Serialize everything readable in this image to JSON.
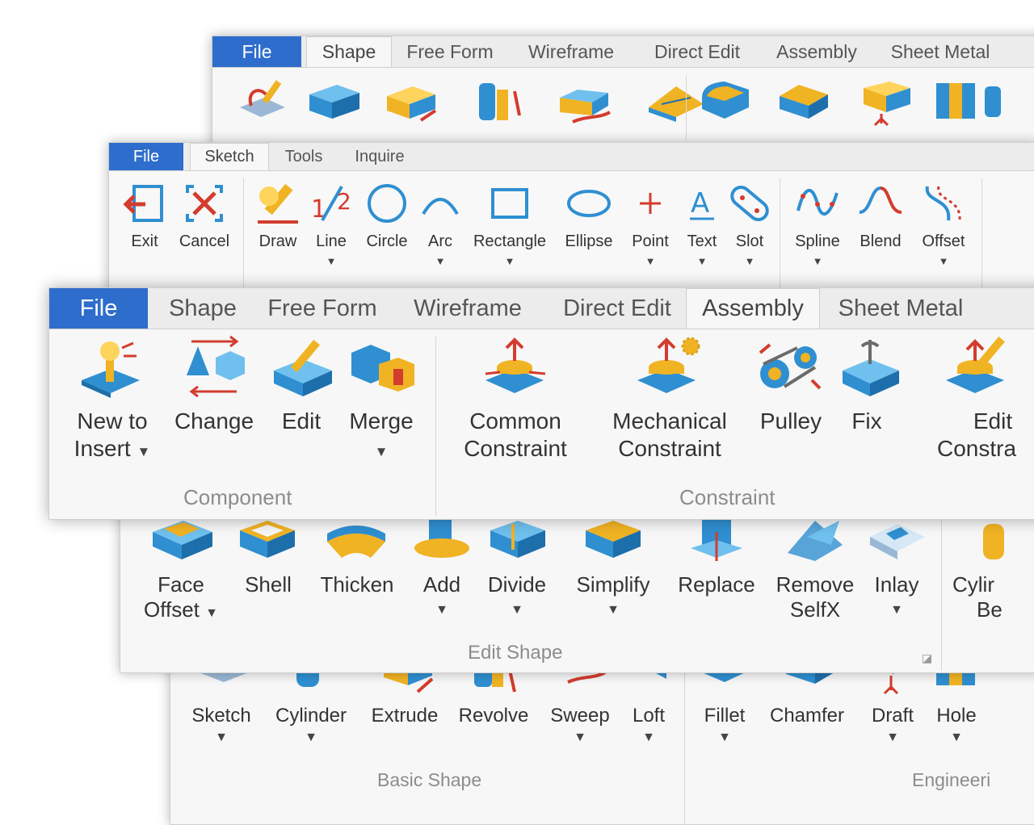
{
  "main_tabs": {
    "file": "File",
    "shape": "Shape",
    "free_form": "Free Form",
    "wireframe": "Wireframe",
    "direct_edit": "Direct Edit",
    "assembly": "Assembly",
    "sheet_metal": "Sheet Metal"
  },
  "sketch_tabs": {
    "file": "File",
    "sketch": "Sketch",
    "tools": "Tools",
    "inquire": "Inquire"
  },
  "sketch_tools": [
    {
      "label": "Exit",
      "icon": "exit-icon"
    },
    {
      "label": "Cancel",
      "icon": "cancel-icon"
    },
    {
      "label": "Draw",
      "icon": "draw-pencil-icon"
    },
    {
      "label": "Line",
      "icon": "line-icon"
    },
    {
      "label": "Circle",
      "icon": "circle-icon"
    },
    {
      "label": "Arc",
      "icon": "arc-icon"
    },
    {
      "label": "Rectangle",
      "icon": "rectangle-icon"
    },
    {
      "label": "Ellipse",
      "icon": "ellipse-icon"
    },
    {
      "label": "Point",
      "icon": "point-icon"
    },
    {
      "label": "Text",
      "icon": "text-icon"
    },
    {
      "label": "Slot",
      "icon": "slot-icon"
    },
    {
      "label": "Spline",
      "icon": "spline-icon"
    },
    {
      "label": "Blend",
      "icon": "blend-icon"
    },
    {
      "label": "Offset",
      "icon": "offset-icon"
    }
  ],
  "assembly_tools": {
    "new_to_insert": {
      "line1": "New to",
      "line2": "Insert"
    },
    "change": {
      "label": "Change"
    },
    "edit": {
      "label": "Edit"
    },
    "merge": {
      "label": "Merge"
    },
    "common_constraint": {
      "line1": "Common",
      "line2": "Constraint"
    },
    "mechanical_constraint": {
      "line1": "Mechanical",
      "line2": "Constraint"
    },
    "pulley": {
      "label": "Pulley"
    },
    "fix": {
      "label": "Fix"
    },
    "edit_constraint": {
      "line1": "Edit",
      "line2": "Constra"
    }
  },
  "assembly_groups": {
    "component": "Component",
    "constraint": "Constraint"
  },
  "direct_edit_tools": {
    "face_offset": {
      "line1": "Face",
      "line2": "Offset"
    },
    "shell": {
      "label": "Shell"
    },
    "thicken": {
      "label": "Thicken"
    },
    "add": {
      "label": "Add"
    },
    "divide": {
      "label": "Divide"
    },
    "simplify": {
      "label": "Simplify"
    },
    "replace": {
      "label": "Replace"
    },
    "remove_selfx": {
      "line1": "Remove",
      "line2": "SelfX"
    },
    "inlay": {
      "label": "Inlay"
    },
    "cylinder_bend": {
      "line1": "Cylir",
      "line2": "Be"
    }
  },
  "direct_edit_group": {
    "label": "Edit Shape"
  },
  "shape_tools": [
    {
      "label": "Sketch"
    },
    {
      "label": "Cylinder"
    },
    {
      "label": "Extrude"
    },
    {
      "label": "Revolve"
    },
    {
      "label": "Sweep"
    },
    {
      "label": "Loft"
    },
    {
      "label": "Fillet"
    },
    {
      "label": "Chamfer"
    },
    {
      "label": "Draft"
    },
    {
      "label": "Hole"
    }
  ],
  "shape_groups": {
    "basic_shape": "Basic Shape",
    "engineering": "Engineeri"
  },
  "colors": {
    "file_tab": "#2e6dcc",
    "icon_blue": "#2f8fd1",
    "icon_gold": "#f0b323",
    "icon_red": "#d33c2e"
  }
}
